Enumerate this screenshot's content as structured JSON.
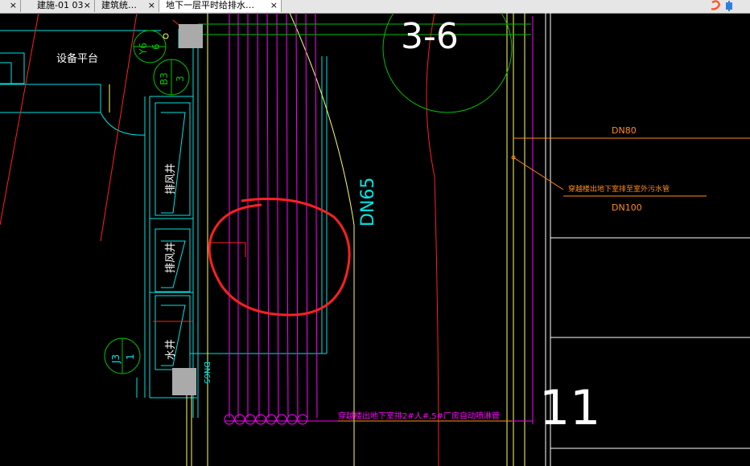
{
  "tabs": [
    {
      "label": "",
      "active": false
    },
    {
      "label": "建施-01 03",
      "active": false
    },
    {
      "label": "建筑统…",
      "active": false
    },
    {
      "label": "地下一层平时给排水…",
      "active": true
    }
  ],
  "drawing": {
    "label_platform": "设备平台",
    "label_shaft1": "排风井",
    "label_shaft2": "排风井",
    "label_shaft3": "水井",
    "bubble_y6_a": "Y6",
    "bubble_y6_b": "6",
    "bubble_b3_a": "B3",
    "bubble_b3_b": "3",
    "bubble_j3_a": "J3",
    "bubble_j3_b": "1",
    "grid_label": "3-6",
    "pipe_dn65_vertical": "DN65",
    "pipe_dn65_small": "DN65",
    "pipe_dn80": "DN80",
    "pipe_dn100": "DN100",
    "annotation_right": "穿越楼出地下室排至室外污水管",
    "annotation_bottom": "穿越楼出地下室排2#人#,5#厂房自动喷淋管",
    "grid_number_bottom": "11"
  },
  "colors": {
    "cyan": "#00e5e5",
    "magenta": "#ff00ff",
    "yellow": "#ffff66",
    "green": "#00c000",
    "red": "#ff2020",
    "orange": "#ff8c1a",
    "white": "#ffffff",
    "gray": "#aaaaaa"
  }
}
